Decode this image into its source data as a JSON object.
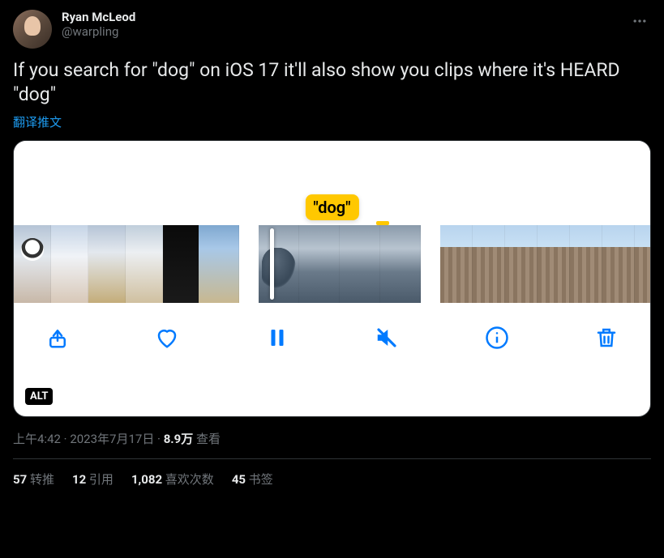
{
  "author": {
    "display_name": "Ryan McLeod",
    "handle": "@warpling"
  },
  "body": "If you search for \"dog\" on iOS 17 it'll also show you clips where it's HEARD \"dog\"",
  "translate_label": "翻译推文",
  "media": {
    "caption_tag": "\"dog\"",
    "alt_badge": "ALT"
  },
  "meta": {
    "time": "上午4:42",
    "date": "2023年7月17日",
    "views_count": "8.9万",
    "views_label": "查看",
    "separator": " · "
  },
  "stats": {
    "retweets": {
      "count": "57",
      "label": "转推"
    },
    "quotes": {
      "count": "12",
      "label": "引用"
    },
    "likes": {
      "count": "1,082",
      "label": "喜欢次数"
    },
    "bookmarks": {
      "count": "45",
      "label": "书签"
    }
  }
}
